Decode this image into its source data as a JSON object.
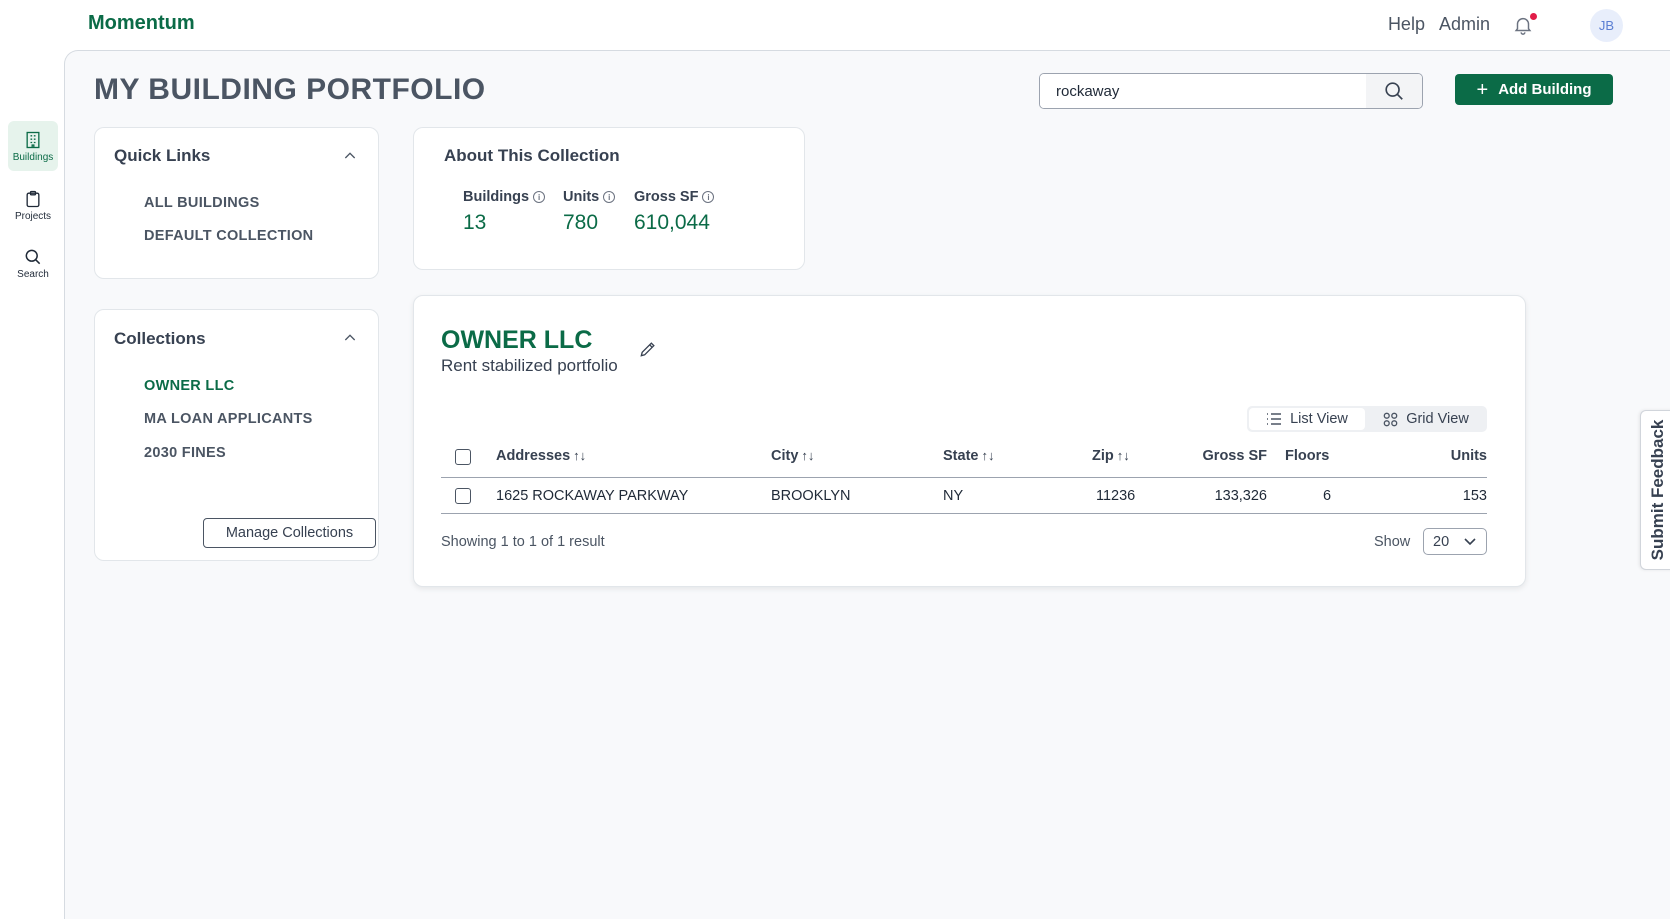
{
  "app": {
    "brand": "Momentum"
  },
  "topnav": {
    "help": "Help",
    "admin": "Admin",
    "avatar_initials": "JB",
    "notification_icon": "bell-icon"
  },
  "rail": {
    "items": [
      {
        "label": "Buildings",
        "icon": "building-icon",
        "active": true
      },
      {
        "label": "Projects",
        "icon": "clipboard-icon",
        "active": false
      },
      {
        "label": "Search",
        "icon": "search-icon",
        "active": false
      }
    ]
  },
  "page": {
    "title": "MY BUILDING PORTFOLIO"
  },
  "search": {
    "value": "rockaway",
    "icon": "search-icon"
  },
  "add_building": {
    "label": "Add Building"
  },
  "quick_links": {
    "title": "Quick Links",
    "items": [
      "ALL BUILDINGS",
      "DEFAULT COLLECTION"
    ]
  },
  "collections": {
    "title": "Collections",
    "items": [
      "OWNER LLC",
      "MA LOAN APPLICANTS",
      "2030 FINES"
    ],
    "active_index": 0,
    "manage_label": "Manage Collections"
  },
  "about": {
    "title": "About This Collection",
    "stats": [
      {
        "label": "Buildings",
        "value": "13"
      },
      {
        "label": "Units",
        "value": "780"
      },
      {
        "label": "Gross SF",
        "value": "610,044"
      }
    ]
  },
  "collection_detail": {
    "name": "OWNER LLC",
    "description": "Rent stabilized portfolio",
    "views": {
      "list": "List View",
      "grid": "Grid View",
      "active": "list"
    },
    "columns": [
      "Addresses",
      "City",
      "State",
      "Zip",
      "Gross SF",
      "Floors",
      "Units"
    ],
    "sort_glyph": "↑↓",
    "rows": [
      {
        "address": "1625 ROCKAWAY PARKWAY",
        "city": "BROOKLYN",
        "state": "NY",
        "zip": "11236",
        "gross_sf": "133,326",
        "floors": "6",
        "units": "153"
      }
    ],
    "showing": "Showing 1 to 1 of 1 result",
    "show_label": "Show",
    "page_size": "20"
  },
  "feedback": {
    "label": "Submit Feedback"
  },
  "colors": {
    "brand": "#0b6b47",
    "background": "#f8f9fb",
    "alert": "#e11d48"
  }
}
